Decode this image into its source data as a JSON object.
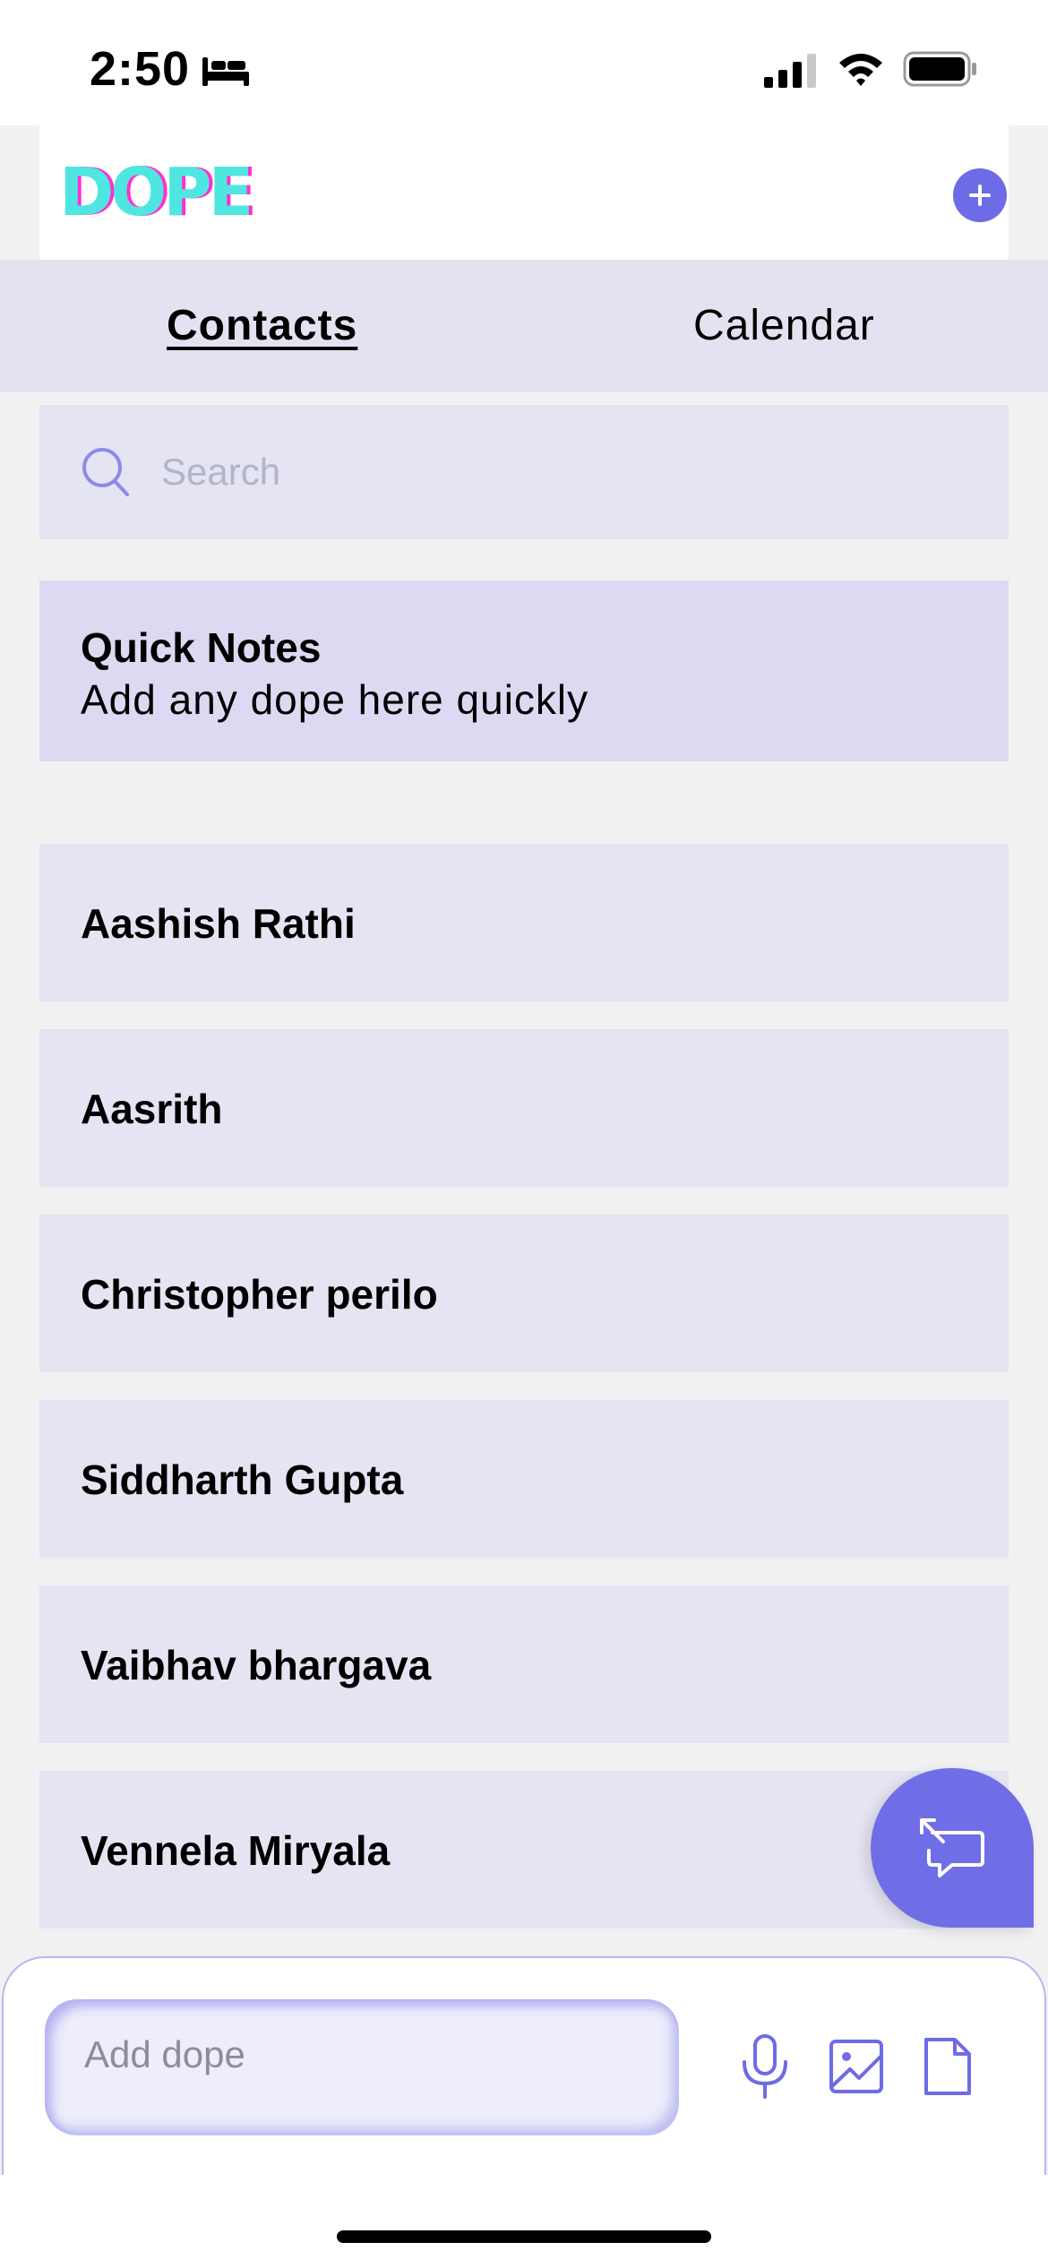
{
  "status_bar": {
    "time": "2:50"
  },
  "header": {
    "logo": "DOPE"
  },
  "tabs": [
    {
      "label": "Contacts",
      "active": true
    },
    {
      "label": "Calendar",
      "active": false
    }
  ],
  "search": {
    "placeholder": "Search"
  },
  "quick_notes": {
    "title": "Quick Notes",
    "subtitle": "Add any dope here quickly"
  },
  "contacts": [
    {
      "name": "Aashish Rathi"
    },
    {
      "name": "Aasrith"
    },
    {
      "name": "Christopher perilo"
    },
    {
      "name": "Siddharth Gupta"
    },
    {
      "name": "Vaibhav bhargava"
    },
    {
      "name": "Vennela Miryala"
    }
  ],
  "compose": {
    "placeholder": "Add dope"
  },
  "colors": {
    "accent": "#6e6be6",
    "tab_bar": "#e3e2f1",
    "card": "#e5e4f2",
    "quick_notes_card": "#dbdaf2",
    "logo_primary": "#4fe6e2",
    "logo_shadow": "#ff2fd0"
  },
  "icons": [
    "bed-icon",
    "signal-icon",
    "wifi-icon",
    "battery-icon",
    "plus-icon",
    "search-icon",
    "chat-expand-icon",
    "mic-icon",
    "image-icon",
    "file-icon"
  ]
}
